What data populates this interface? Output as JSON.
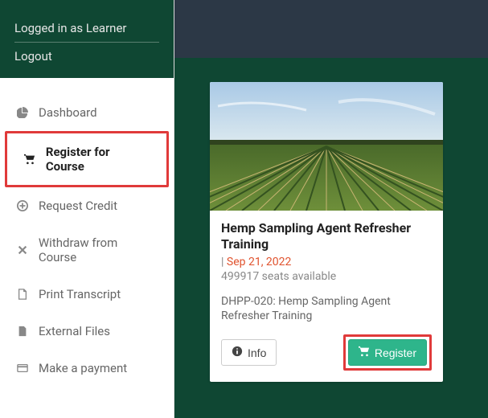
{
  "sidebar": {
    "logged_in_label": "Logged in as Learner",
    "logout_label": "Logout",
    "items": [
      {
        "label": "Dashboard"
      },
      {
        "label": "Register for Course"
      },
      {
        "label": "Request Credit"
      },
      {
        "label": "Withdraw from Course"
      },
      {
        "label": "Print Transcript"
      },
      {
        "label": "External Files"
      },
      {
        "label": "Make a payment"
      }
    ]
  },
  "card": {
    "title": "Hemp Sampling Agent Refresher Training",
    "meta_prefix": "| ",
    "date": "Sep 21, 2022",
    "seats": "499917 seats available",
    "desc": "DHPP-020: Hemp Sampling Agent Refresher Training",
    "info_label": "Info",
    "register_label": "Register"
  },
  "colors": {
    "sidebar_bg": "#0f4733",
    "topbar_bg": "#2c3846",
    "accent_register": "#2eb58b",
    "highlight": "#e03a3a",
    "date": "#e0522d"
  }
}
